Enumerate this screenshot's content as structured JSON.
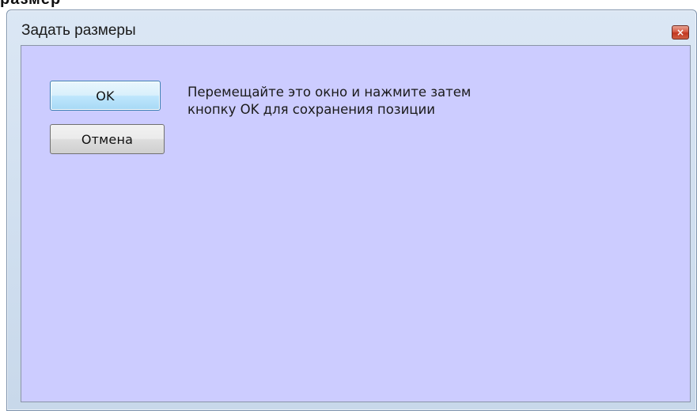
{
  "window": {
    "title": "Задать размеры",
    "close_glyph": "×"
  },
  "background_text": "размер",
  "buttons": {
    "ok_label": "OK",
    "cancel_label": "Отмена"
  },
  "message": {
    "line1": "Перемещайте это окно и нажмите затем",
    "line2": "кнопку OK для сохранения позиции"
  },
  "colors": {
    "client_background": "#ccccff",
    "titlebar": "#cfdeef",
    "close_button": "#c2361f"
  }
}
